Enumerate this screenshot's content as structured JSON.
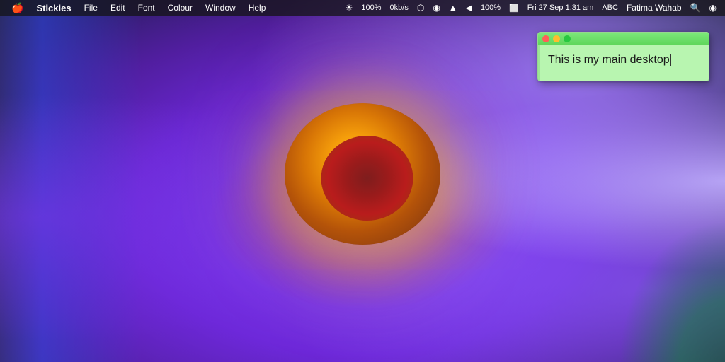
{
  "menubar": {
    "apple_symbol": "🍎",
    "app_name": "Stickies",
    "menus": [
      "File",
      "Edit",
      "Font",
      "Colour",
      "Window",
      "Help"
    ],
    "status_right": {
      "brightness_icon": "☀",
      "percentage1": "100%",
      "network_up": "↑",
      "speed": "0kb/s",
      "bluetooth": "⬡",
      "airport": "◉",
      "wifi": "▲",
      "sound": "◀",
      "battery_percent": "100%",
      "battery_icon": "🔋",
      "datetime": "Fri 27 Sep  1:31 am",
      "keyboard_icon": "ABC",
      "username": "Fatima Wahab",
      "search_icon": "🔍",
      "notification_icon": "◉"
    }
  },
  "sticky_note": {
    "title": "",
    "content": "This is my main desktop",
    "buttons": {
      "close": "close",
      "minimize": "minimize",
      "expand": "expand"
    },
    "bg_color": "#b8f5b0",
    "titlebar_color": "#5dd65a"
  },
  "desktop": {
    "bg_description": "Purple flower macro photography"
  }
}
